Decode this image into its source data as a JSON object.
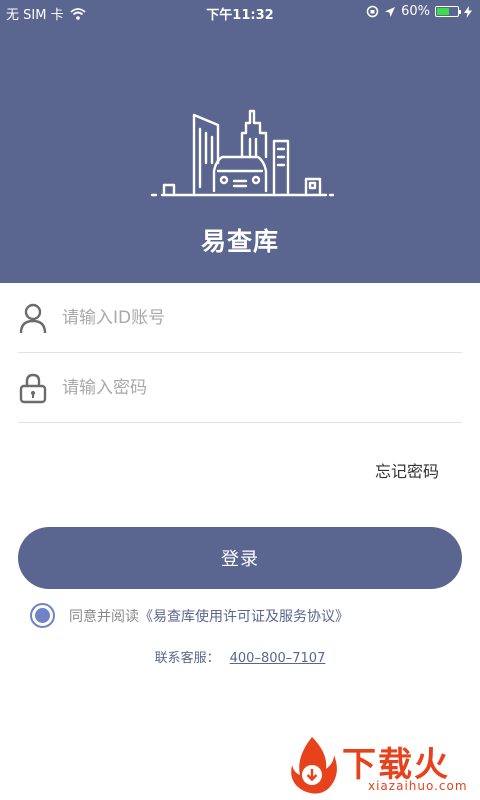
{
  "status_bar": {
    "carrier": "无 SIM 卡",
    "time": "下午11:32",
    "battery": "60%",
    "battery_level": 0.6,
    "icons": [
      "wifi-icon",
      "orientation-lock-icon",
      "location-arrow-icon",
      "battery-icon",
      "charging-icon"
    ]
  },
  "header": {
    "app_title": "易查库",
    "illustration": "city-car-icon",
    "background": "#5b6690"
  },
  "form": {
    "id_field": {
      "placeholder": "请输入ID账号",
      "value": "",
      "icon": "user-icon"
    },
    "password_field": {
      "placeholder": "请输入密码",
      "value": "",
      "icon": "lock-icon"
    },
    "forgot_password": "忘记密码"
  },
  "login_button": "登录",
  "agreement": {
    "checked": true,
    "prefix": "同意并阅读",
    "link": "《易查库使用许可证及服务协议》"
  },
  "contact": {
    "label": "联系客服：",
    "phone": "400–800–7107"
  },
  "watermark": {
    "brand": "下载火",
    "url": "xiazaihuo.com"
  },
  "colors": {
    "primary": "#5b6690",
    "radio": "#6f84c8",
    "watermark": "#e8421c"
  }
}
